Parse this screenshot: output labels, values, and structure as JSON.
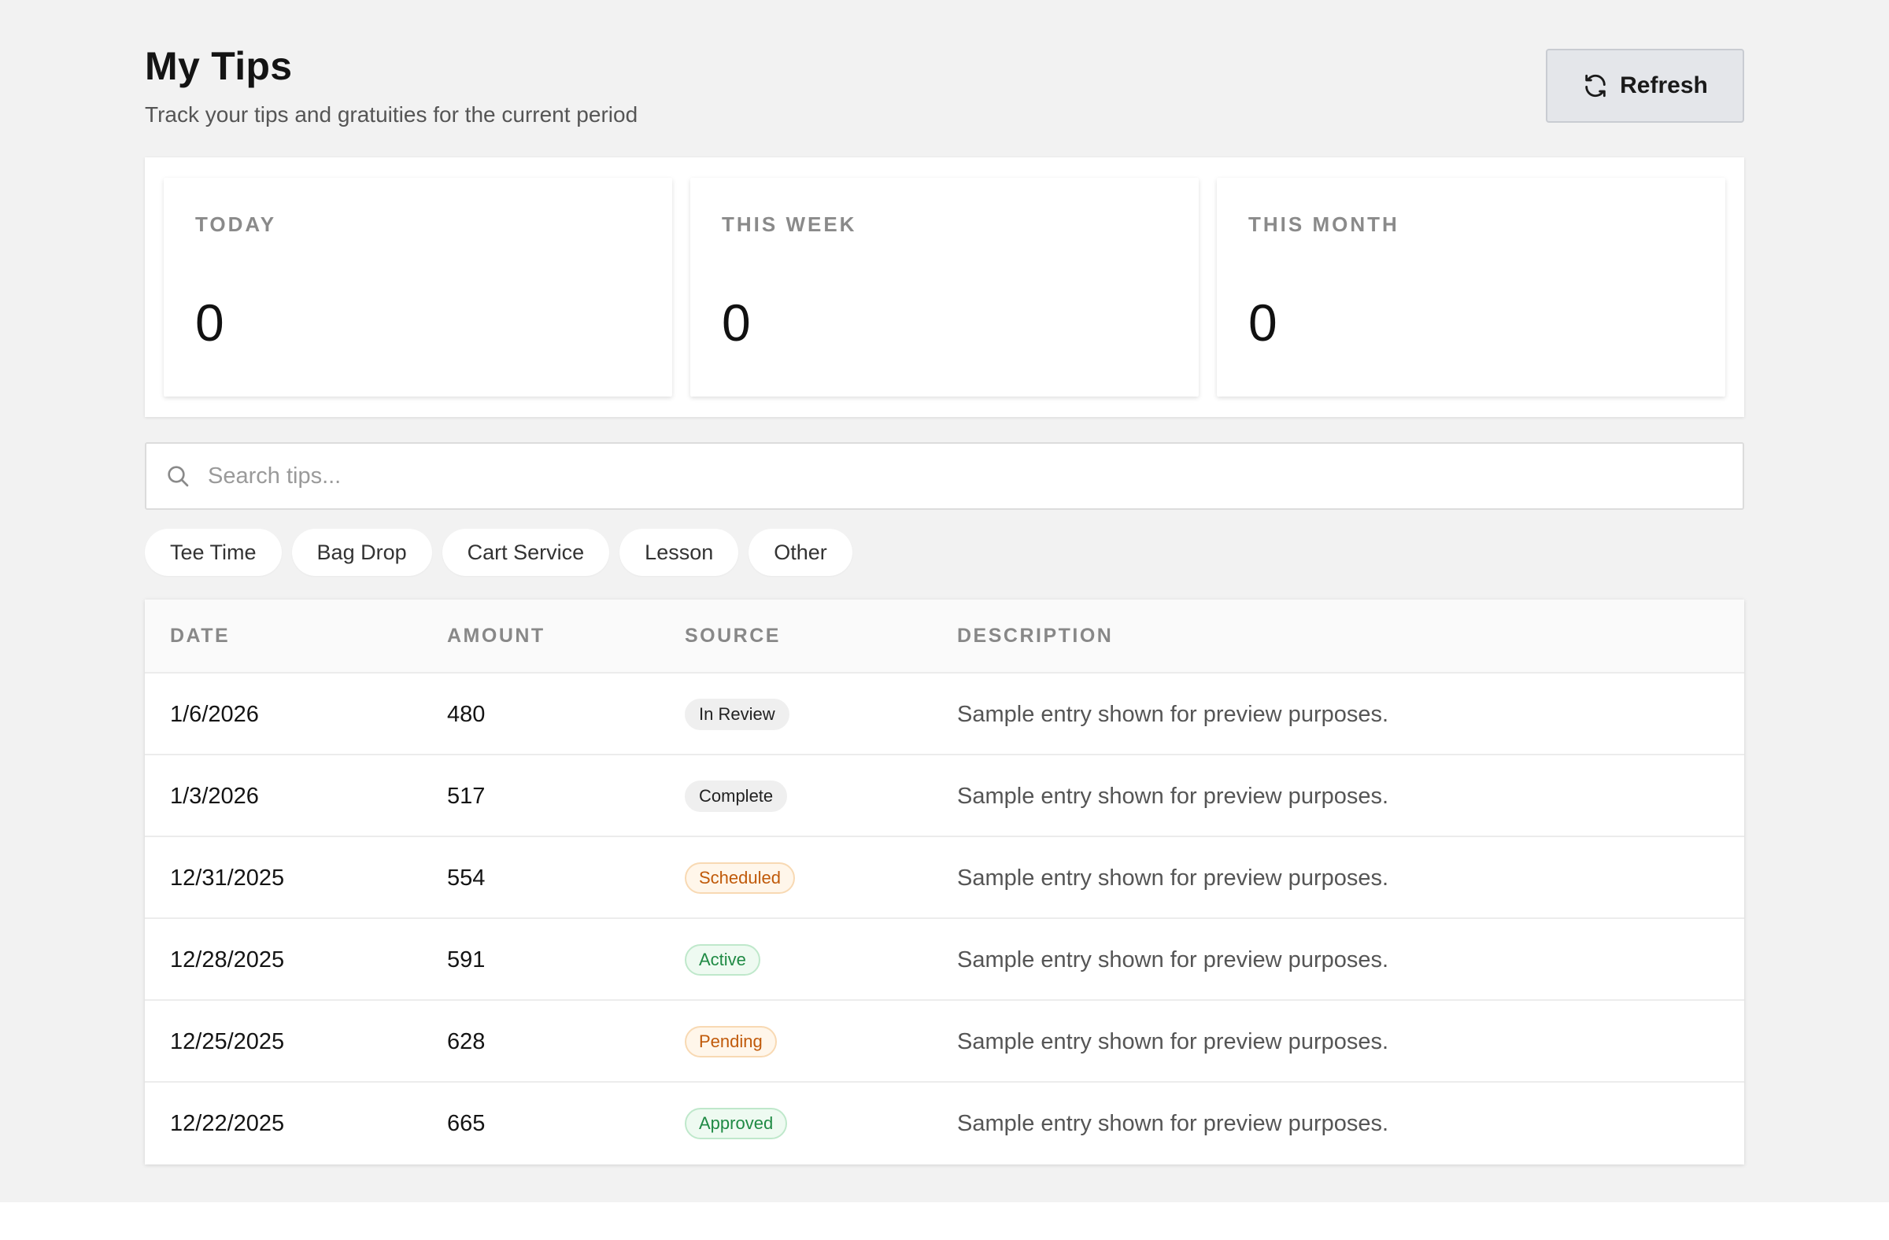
{
  "header": {
    "title": "My Tips",
    "subtitle": "Track your tips and gratuities for the current period"
  },
  "toolbar": {
    "refresh_label": "Refresh",
    "refresh_icon": "refresh-icon"
  },
  "stats": [
    {
      "label": "TODAY",
      "value": "0"
    },
    {
      "label": "THIS WEEK",
      "value": "0"
    },
    {
      "label": "THIS MONTH",
      "value": "0"
    }
  ],
  "search": {
    "placeholder": "Search tips...",
    "value": "",
    "icon": "search-icon"
  },
  "filters": [
    "Tee Time",
    "Bag Drop",
    "Cart Service",
    "Lesson",
    "Other"
  ],
  "table": {
    "columns": [
      "DATE",
      "AMOUNT",
      "SOURCE",
      "DESCRIPTION"
    ],
    "rows": [
      {
        "date": "1/6/2026",
        "amount": "480",
        "source": "In Review",
        "source_style": "neutral",
        "description": "Sample entry shown for preview purposes."
      },
      {
        "date": "1/3/2026",
        "amount": "517",
        "source": "Complete",
        "source_style": "neutral",
        "description": "Sample entry shown for preview purposes."
      },
      {
        "date": "12/31/2025",
        "amount": "554",
        "source": "Scheduled",
        "source_style": "orange",
        "description": "Sample entry shown for preview purposes."
      },
      {
        "date": "12/28/2025",
        "amount": "591",
        "source": "Active",
        "source_style": "green",
        "description": "Sample entry shown for preview purposes."
      },
      {
        "date": "12/25/2025",
        "amount": "628",
        "source": "Pending",
        "source_style": "orange",
        "description": "Sample entry shown for preview purposes."
      },
      {
        "date": "12/22/2025",
        "amount": "665",
        "source": "Approved",
        "source_style": "green",
        "description": "Sample entry shown for preview purposes."
      }
    ]
  },
  "colors": {
    "page_background": "#f2f2f2",
    "button_background": "#e4e6ea",
    "badge_orange_text": "#c05a0a",
    "badge_green_text": "#1f8a44",
    "badge_neutral_background": "#efefef"
  }
}
